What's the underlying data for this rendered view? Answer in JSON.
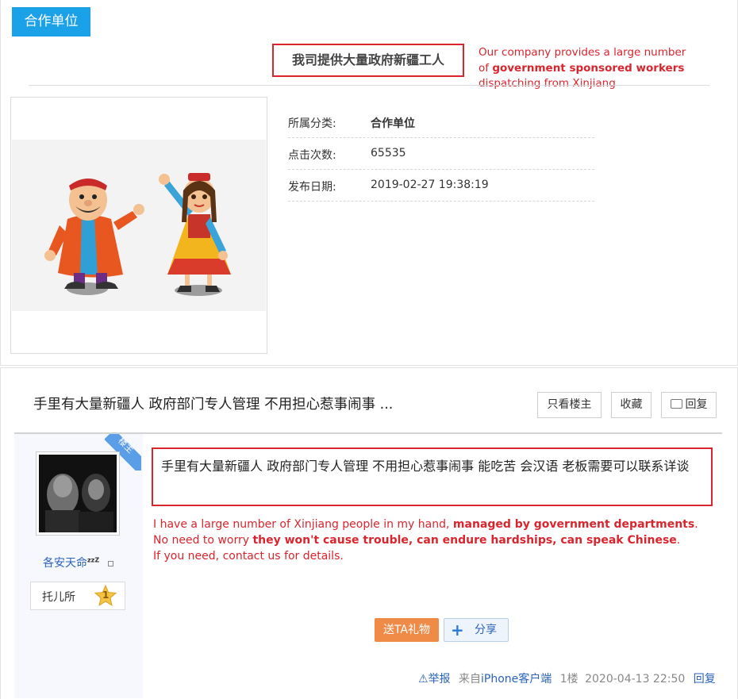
{
  "top": {
    "category_tab": "合作单位",
    "company_title": "我司提供大量政府新疆工人",
    "annotation": {
      "line1": "Our company provides a large number",
      "line2_prefix": "of ",
      "line2_bold": "government sponsored workers",
      "line3": "dispatching from Xinjiang"
    },
    "info": {
      "category_label": "所属分类:",
      "category_value": "合作单位",
      "clicks_label": "点击次数:",
      "clicks_value": "65535",
      "date_label": "发布日期:",
      "date_value": "2019-02-27 19:38:19"
    }
  },
  "thread": {
    "title": "手里有大量新疆人 政府部门专人管理 不用担心惹事闹事 ...",
    "buttons": {
      "only_op": "只看楼主",
      "favorite": "收藏",
      "reply": "回复"
    }
  },
  "post": {
    "op_badge": "楼主",
    "username": "各安天命",
    "username_suffix": "zzZ",
    "user_title": "托儿所",
    "user_level": "1",
    "body": "手里有大量新疆人 政府部门专人管理 不用担心惹事闹事 能吃苦 会汉语 老板需要可以联系详谈",
    "annotation": {
      "l1_a": "I have a large number of Xinjiang people in my hand, ",
      "l1_b": "managed by government departments",
      "l1_c": ".",
      "l2_a": "No need to worry ",
      "l2_b": "they won't cause trouble, can endure hardships, can speak Chinese",
      "l2_c": ".",
      "l3": "If you need, contact us for details."
    },
    "gift_button": "送TA礼物",
    "share_button": "分享",
    "footer": {
      "report": "举报",
      "source_prefix": "来自",
      "source_link": "iPhone客户端",
      "floor": "1楼",
      "time": "2020-04-13 22:50",
      "reply": "回复"
    }
  },
  "colors": {
    "accent_blue": "#1aa1e8",
    "annotation_red": "#d9252e",
    "link_blue": "#2a63b8",
    "gift_orange": "#f08a47"
  }
}
